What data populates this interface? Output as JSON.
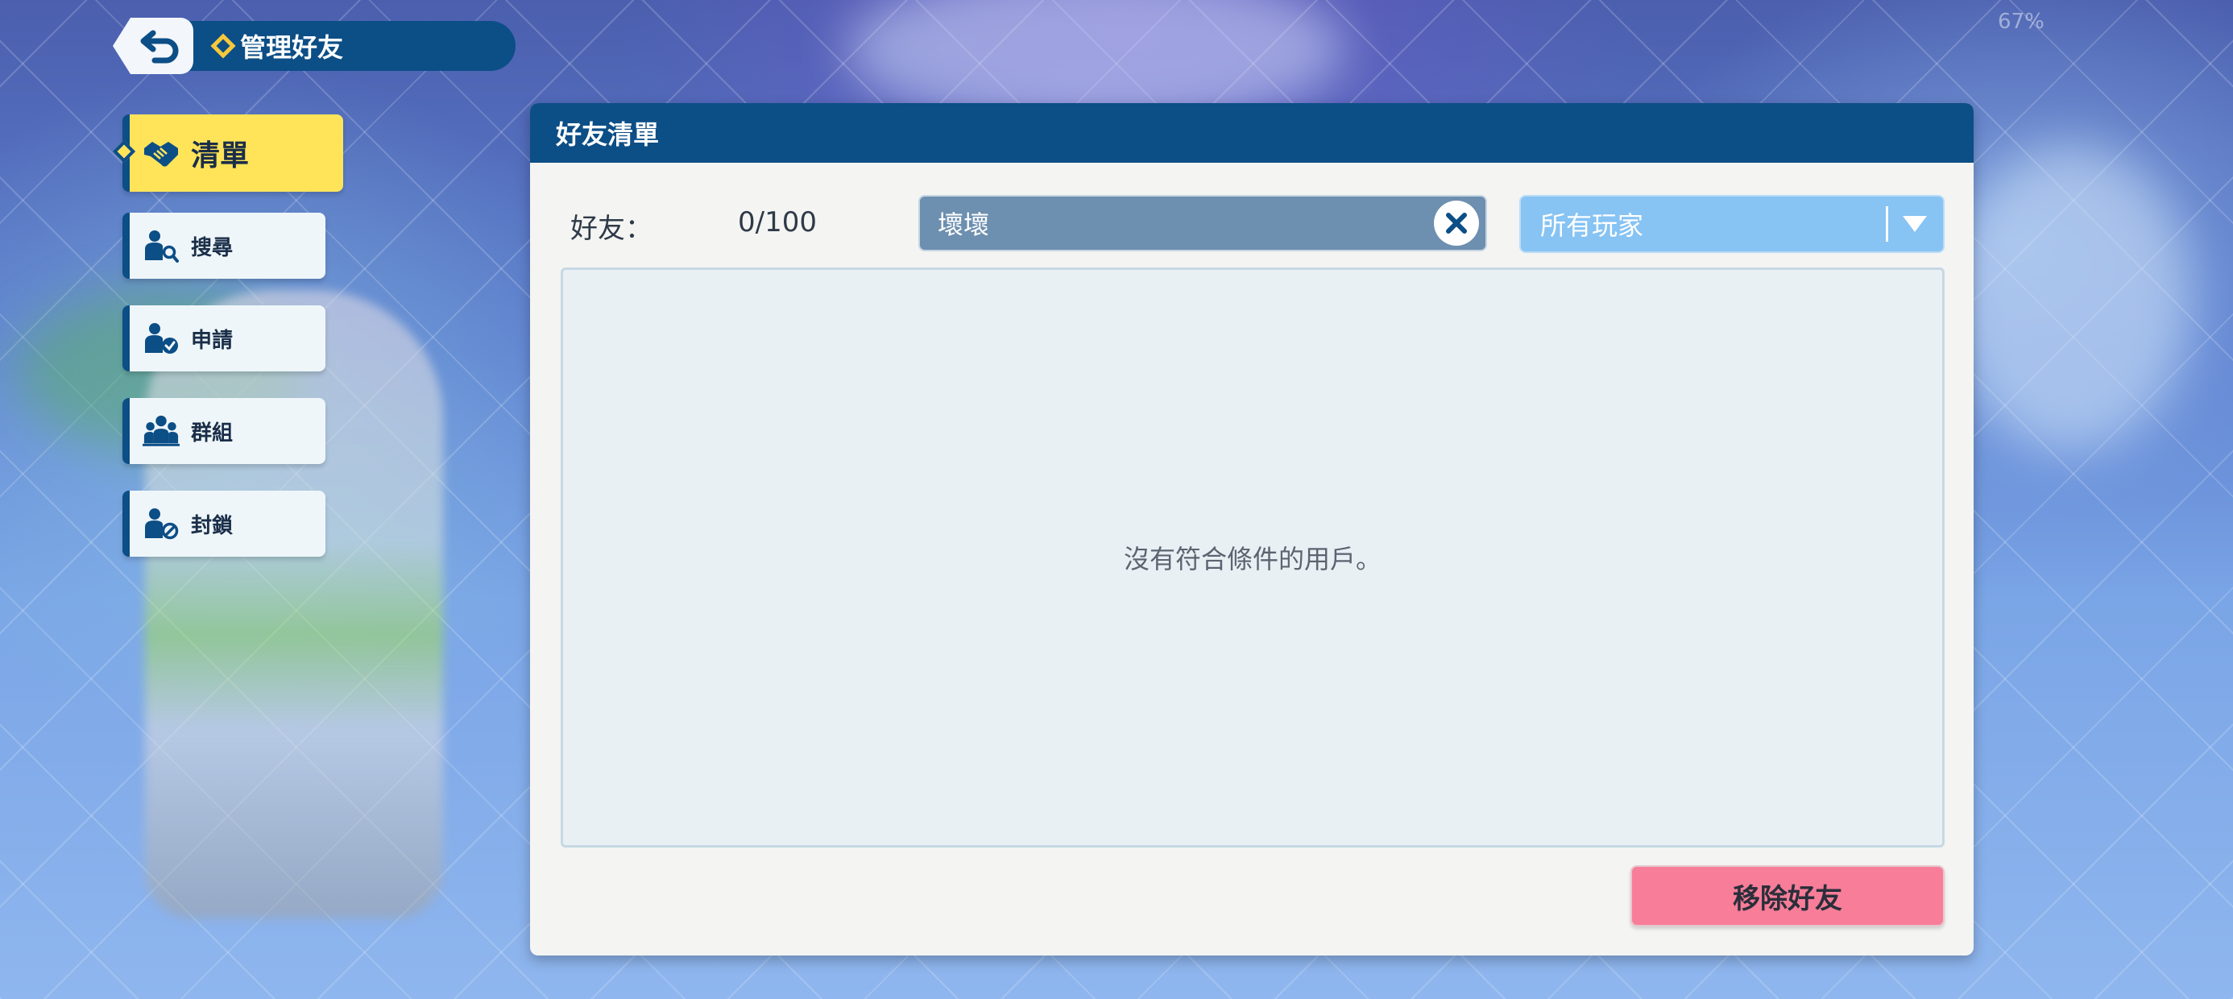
{
  "status": {
    "battery": "67%"
  },
  "header": {
    "title": "管理好友"
  },
  "nav": {
    "items": [
      {
        "label": "清單",
        "icon": "handshake-icon",
        "active": true
      },
      {
        "label": "搜尋",
        "icon": "user-search-icon",
        "active": false
      },
      {
        "label": "申請",
        "icon": "user-check-icon",
        "active": false
      },
      {
        "label": "群組",
        "icon": "group-icon",
        "active": false
      },
      {
        "label": "封鎖",
        "icon": "user-block-icon",
        "active": false
      }
    ]
  },
  "panel": {
    "title": "好友清單",
    "friends_label": "好友：",
    "friends_count": "0/100",
    "search_value": "壞壞",
    "filter_value": "所有玩家",
    "empty_message": "沒有符合條件的用戶。",
    "remove_button": "移除好友"
  },
  "colors": {
    "header_blue": "#0c4e86",
    "active_yellow": "#ffe45a",
    "remove_pink": "#f77d98",
    "filter_blue": "#87c3f3"
  }
}
